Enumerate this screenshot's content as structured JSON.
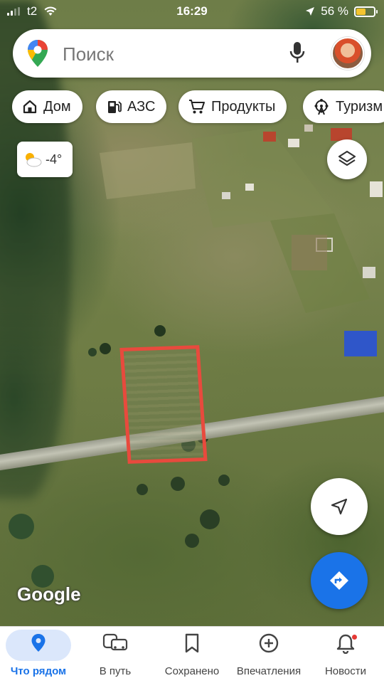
{
  "status_bar": {
    "carrier": "t2",
    "time": "16:29",
    "battery_text": "56 %",
    "battery_level": 0.56
  },
  "search": {
    "placeholder": "Поиск"
  },
  "chips": [
    {
      "label": "Дом",
      "icon": "home-icon"
    },
    {
      "label": "АЗС",
      "icon": "gas-station-icon"
    },
    {
      "label": "Продукты",
      "icon": "shopping-cart-icon"
    },
    {
      "label": "Туризм",
      "icon": "ferris-wheel-icon"
    }
  ],
  "weather": {
    "temperature": "-4°",
    "icon": "partly-cloudy-icon"
  },
  "map": {
    "attribution": "Google",
    "parcel_outline_color": "#e84a3d"
  },
  "bottom_nav": [
    {
      "label": "Что рядом",
      "icon": "location-pin-icon",
      "active": true
    },
    {
      "label": "В путь",
      "icon": "commute-icon",
      "active": false
    },
    {
      "label": "Сохранено",
      "icon": "bookmark-icon",
      "active": false
    },
    {
      "label": "Впечатления",
      "icon": "add-circle-icon",
      "active": false
    },
    {
      "label": "Новости",
      "icon": "bell-icon",
      "active": false,
      "badge": true
    }
  ],
  "colors": {
    "accent": "#1a73e8",
    "active_pill": "#dbe7fb"
  }
}
